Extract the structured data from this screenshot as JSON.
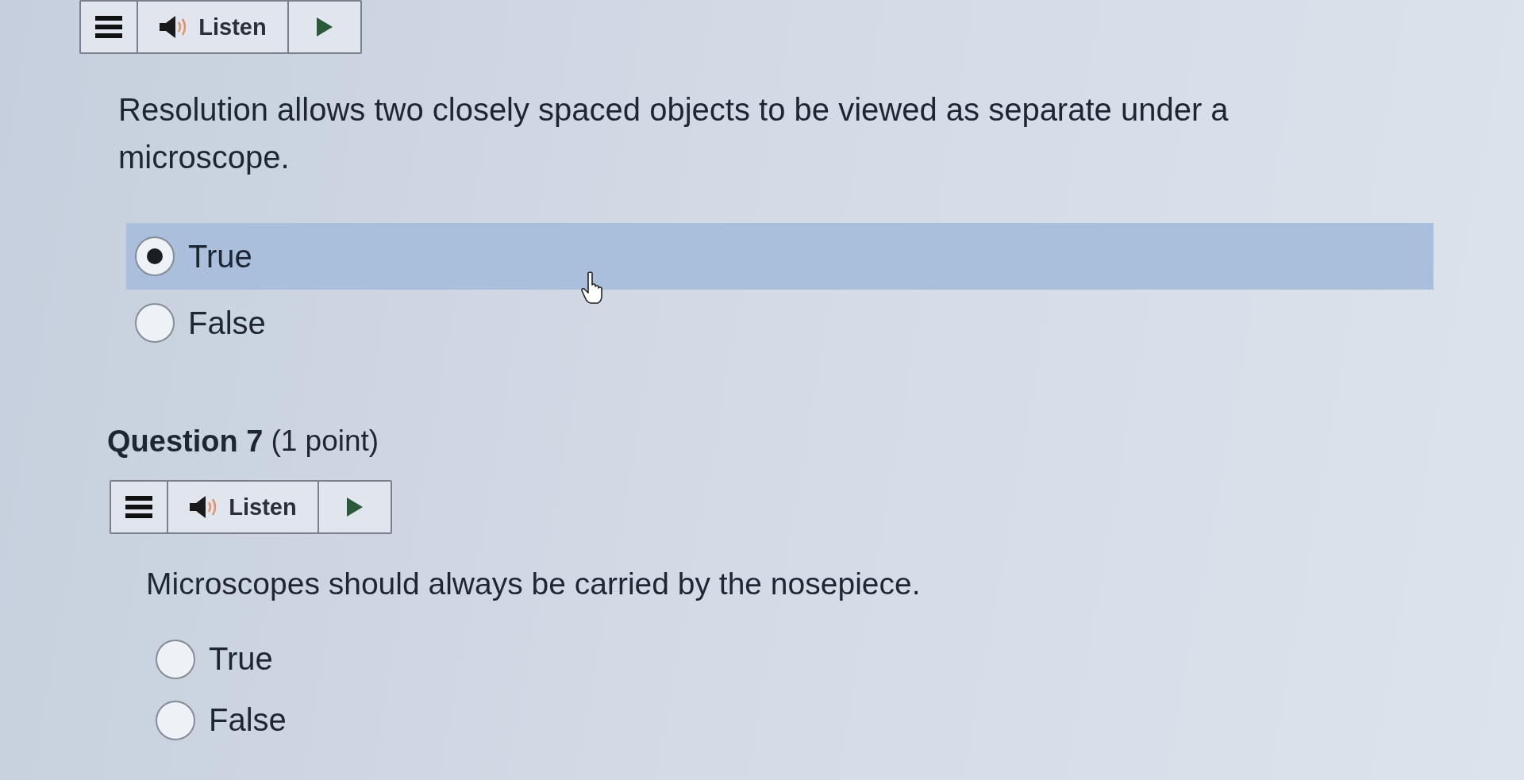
{
  "questions": [
    {
      "toolbar": {
        "listen_label": "Listen"
      },
      "prompt": "Resolution allows two closely spaced objects to be viewed as separate under a microscope.",
      "options": [
        {
          "label": "True",
          "selected": true,
          "highlighted": true
        },
        {
          "label": "False",
          "selected": false,
          "highlighted": false
        }
      ]
    },
    {
      "heading": "Question 7",
      "points": "(1 point)",
      "toolbar": {
        "listen_label": "Listen"
      },
      "prompt": "Microscopes should always be carried by the nosepiece.",
      "options": [
        {
          "label": "True",
          "selected": false,
          "highlighted": false
        },
        {
          "label": "False",
          "selected": false,
          "highlighted": false
        }
      ]
    }
  ]
}
